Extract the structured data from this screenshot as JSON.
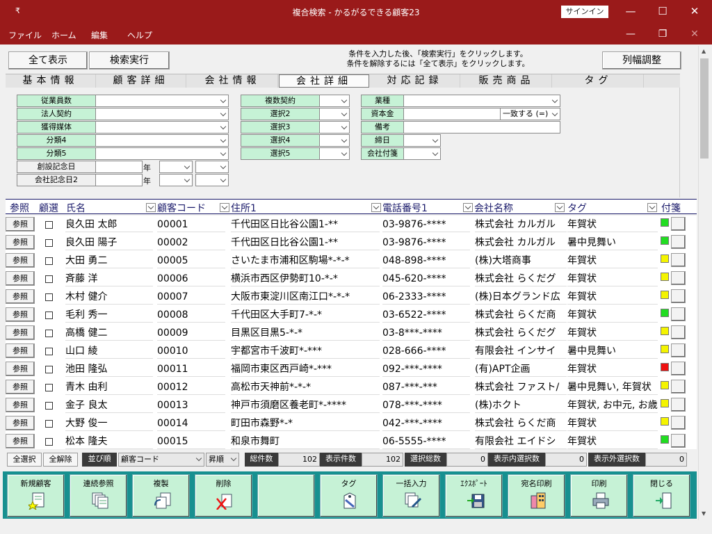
{
  "window": {
    "title": "複合検索 - かるがるできる顧客23",
    "signin": "サインイン",
    "menu_glyph": "₹",
    "minimize": "—",
    "maximize": "☐",
    "close": "✕",
    "restore": "❐"
  },
  "menu": [
    "ファイル",
    "ホーム",
    "編集",
    "ヘルプ"
  ],
  "toolbar_top": {
    "show_all": "全て表示",
    "search": "検索実行",
    "hint_line1": "条件を入力した後、「検索実行」をクリックします。",
    "hint_line2": "条件を解除するには「全て表示」をクリックします。",
    "col_width": "列幅調整"
  },
  "tabs": [
    "基本情報",
    "顧客詳細",
    "会社情報",
    "会社詳細",
    "対応記録",
    "販売商品",
    "タグ"
  ],
  "form": {
    "left": [
      "従業員数",
      "法人契約",
      "獲得媒体",
      "分類4",
      "分類5"
    ],
    "left_dates": [
      "創設記念日",
      "会社記念日2"
    ],
    "year_label": "年",
    "middle": [
      "複数契約",
      "選択2",
      "選択3",
      "選択4",
      "選択5"
    ],
    "right": [
      "業種",
      "資本金",
      "備考",
      "締日",
      "会社付箋"
    ],
    "capital_op": "一致する (=)"
  },
  "grid": {
    "headers": {
      "ref": "参照",
      "select": "顧選",
      "name": "氏名",
      "code": "顧客コード",
      "address": "住所1",
      "phone": "電話番号1",
      "company": "会社名称",
      "tag": "タグ",
      "sticky": "付箋"
    },
    "ref_button": "参照",
    "rows": [
      {
        "name": "良久田 太郎",
        "code": "00001",
        "address": "千代田区日比谷公園1-**",
        "phone": "03-9876-****",
        "company": "株式会社 カルガル",
        "tag": "年賀状",
        "color": "#22dd22"
      },
      {
        "name": "良久田 陽子",
        "code": "00002",
        "address": "千代田区日比谷公園1-**",
        "phone": "03-9876-****",
        "company": "株式会社 カルガル",
        "tag": "暑中見舞い",
        "color": "#22dd22"
      },
      {
        "name": "大田 勇二",
        "code": "00005",
        "address": "さいたま市浦和区駒場*-*-*",
        "phone": "048-898-****",
        "company": "(株)大塔商事",
        "tag": "年賀状",
        "color": "#f4f400"
      },
      {
        "name": "斉藤 洋",
        "code": "00006",
        "address": "横浜市西区伊勢町10-*-*",
        "phone": "045-620-****",
        "company": "株式会社 らくだグ",
        "tag": "年賀状",
        "color": "#f4f400"
      },
      {
        "name": "木村 健介",
        "code": "00007",
        "address": "大阪市東淀川区南江口*-*-*",
        "phone": "06-2333-****",
        "company": "(株)日本グランド広",
        "tag": "年賀状",
        "color": "#f4f400"
      },
      {
        "name": "毛利 秀一",
        "code": "00008",
        "address": "千代田区大手町7-*-*",
        "phone": "03-6522-****",
        "company": "株式会社 らくだ商",
        "tag": "年賀状",
        "color": "#22dd22"
      },
      {
        "name": "高橋 健二",
        "code": "00009",
        "address": "目黒区目黒5-*-*",
        "phone": "03-8***-****",
        "company": "株式会社 らくだグ",
        "tag": "年賀状",
        "color": "#f4f400"
      },
      {
        "name": "山口 綾",
        "code": "00010",
        "address": "宇都宮市千波町*-***",
        "phone": "028-666-****",
        "company": "有限会社 インサイ",
        "tag": "暑中見舞い",
        "color": "#f4f400"
      },
      {
        "name": "池田 隆弘",
        "code": "00011",
        "address": "福岡市東区西戸崎*-***",
        "phone": "092-***-****",
        "company": "(有)APT企画",
        "tag": "年賀状",
        "color": "#ee1111"
      },
      {
        "name": "青木 由利",
        "code": "00012",
        "address": "高松市天神前*-*-*",
        "phone": "087-***-***",
        "company": "株式会社 ファスト/",
        "tag": "暑中見舞い, 年賀状",
        "color": "#f4f400"
      },
      {
        "name": "金子 良太",
        "code": "00013",
        "address": "神戸市須磨区養老町*-****",
        "phone": "078-***-****",
        "company": "(株)ホクト",
        "tag": "年賀状, お中元, お歳暮",
        "color": "#f4f400"
      },
      {
        "name": "大野 俊一",
        "code": "00014",
        "address": "町田市森野*-*",
        "phone": "042-***-****",
        "company": "株式会社 らくだ商",
        "tag": "年賀状",
        "color": "#f4f400"
      },
      {
        "name": "松本 隆夫",
        "code": "00015",
        "address": "和泉市舞町",
        "phone": "06-5555-****",
        "company": "有限会社 エイドシ",
        "tag": "年賀状",
        "color": "#22dd22"
      }
    ]
  },
  "status": {
    "select_all": "全選択",
    "deselect_all": "全解除",
    "sort_label": "並び順",
    "sort_field": "顧客コード",
    "sort_dir": "昇順",
    "total_label": "総件数",
    "total": "102",
    "shown_label": "表示件数",
    "shown": "102",
    "selected_label": "選択総数",
    "selected": "0",
    "shown_sel_label": "表示内選択数",
    "shown_sel": "0",
    "hidden_sel_label": "表示外選択数",
    "hidden_sel": "0"
  },
  "bottom": [
    "新規顧客",
    "連続参照",
    "複製",
    "削除",
    "タグ",
    "一括入力",
    "ｴｸｽﾎﾟｰﾄ",
    "宛名印刷",
    "印刷",
    "閉じる"
  ]
}
